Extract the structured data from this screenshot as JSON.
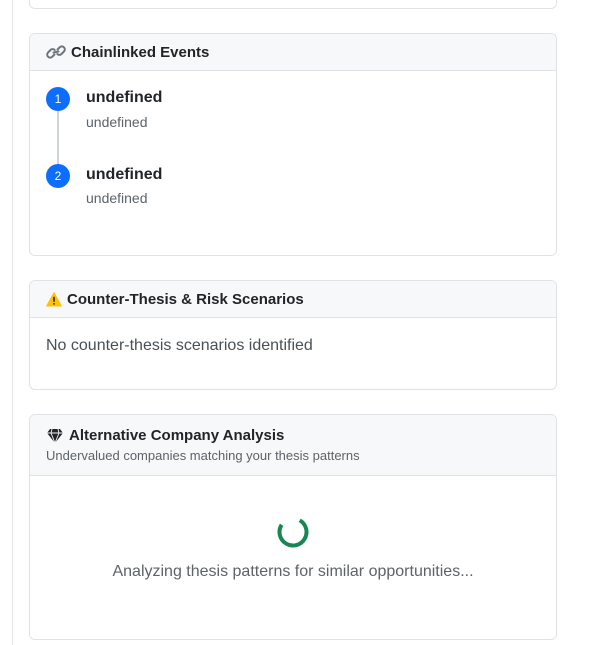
{
  "chainlinked": {
    "title": "Chainlinked Events",
    "events": [
      {
        "number": "1",
        "title": "undefined",
        "description": "undefined"
      },
      {
        "number": "2",
        "title": "undefined",
        "description": "undefined"
      }
    ]
  },
  "counter_thesis": {
    "title": "Counter-Thesis & Risk Scenarios",
    "empty_message": "No counter-thesis scenarios identified"
  },
  "alternative": {
    "title": "Alternative Company Analysis",
    "subtitle": "Undervalued companies matching your thesis patterns",
    "loading_message": "Analyzing thesis patterns for similar opportunities..."
  },
  "colors": {
    "accent_blue": "#0d6efd",
    "warning": "#ffc107",
    "spinner_green": "#198754"
  },
  "icons": [
    "link-icon",
    "warning-icon",
    "gem-icon",
    "spinner-icon"
  ]
}
